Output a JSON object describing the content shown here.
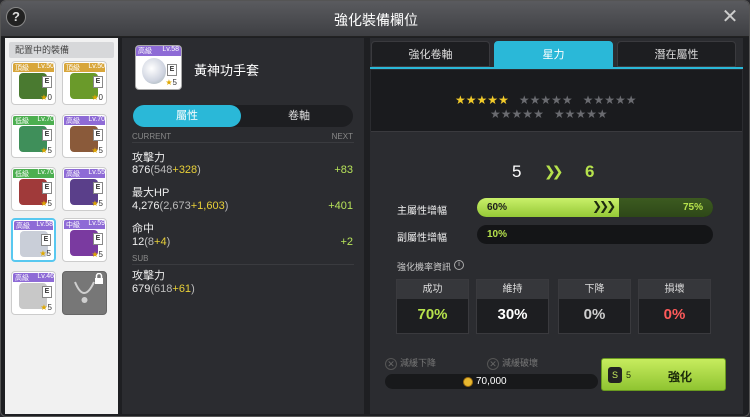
{
  "window": {
    "title": "強化裝備欄位",
    "help_label": "?",
    "close_label": "✕"
  },
  "equipment": {
    "header": "配置中的裝備",
    "slots": [
      {
        "tier": "頂級",
        "level": "Lv.50",
        "badge": "E",
        "stars": "0",
        "icon": "helmet-icon",
        "tier_color": "#d8a63a"
      },
      {
        "tier": "頂級",
        "level": "Lv.50",
        "badge": "E",
        "stars": "0",
        "icon": "cloak-icon",
        "tier_color": "#d8a63a"
      },
      {
        "tier": "低級",
        "level": "Lv.70",
        "badge": "E",
        "stars": "5",
        "icon": "top-armor-icon",
        "tier_color": "#4caf50"
      },
      {
        "tier": "高級",
        "level": "Lv.70",
        "badge": "E",
        "stars": "5",
        "icon": "shoes-icon",
        "tier_color": "#8e6bd6"
      },
      {
        "tier": "低級",
        "level": "Lv.70",
        "badge": "E",
        "stars": "5",
        "icon": "pants-icon",
        "tier_color": "#4caf50"
      },
      {
        "tier": "高級",
        "level": "Lv.55",
        "badge": "E",
        "stars": "5",
        "icon": "belt-icon",
        "tier_color": "#8e6bd6"
      },
      {
        "tier": "高級",
        "level": "Lv.58",
        "badge": "E",
        "stars": "5",
        "icon": "glove-icon",
        "tier_color": "#8e6bd6"
      },
      {
        "tier": "中級",
        "level": "Lv.59",
        "badge": "E",
        "stars": "5",
        "icon": "shoulder-icon",
        "tier_color": "#8e6bd6"
      },
      {
        "tier": "高級",
        "level": "Lv.46",
        "badge": "E",
        "stars": "5",
        "icon": "ring-icon",
        "tier_color": "#8e6bd6"
      }
    ]
  },
  "item": {
    "tier": "高級",
    "level": "Lv.58",
    "badge": "E",
    "stars": "5",
    "name": "黃神功手套",
    "tabs": {
      "attributes": "屬性",
      "scrolls": "卷軸"
    },
    "current_caption": "CURRENT",
    "next_caption": "NEXT",
    "sub_caption": "SUB",
    "stats": [
      {
        "name": "攻擊力",
        "total": "876",
        "base": "(548",
        "bonus": "+328",
        "close": ")",
        "next": "+83"
      },
      {
        "name": "最大HP",
        "total": "4,276",
        "base": "(2,673",
        "bonus": "+1,603",
        "close": ")",
        "next": "+401"
      },
      {
        "name": "命中",
        "total": "12",
        "base": "(8",
        "bonus": "+4",
        "close": ")",
        "next": "+2"
      }
    ],
    "sub_stats": [
      {
        "name": "攻擊力",
        "total": "679",
        "base": "(618",
        "bonus": "+61",
        "close": ")"
      }
    ]
  },
  "enhance": {
    "tabs": {
      "scroll": "強化卷軸",
      "starforce": "星力",
      "potential": "潛在屬性"
    },
    "stars_filled": 5,
    "stars_total": 25,
    "current_star": "5",
    "next_star": "6",
    "main_label": "主屬性增幅",
    "main_current": "60%",
    "main_next": "75%",
    "main_current_fraction": 0.6,
    "main_next_fraction": 0.75,
    "sub_label": "副屬性增幅",
    "sub_current": "10%",
    "prob_title": "強化機率資訊",
    "probabilities": [
      {
        "label": "成功",
        "value": "70%",
        "color": "#b6e24c"
      },
      {
        "label": "維持",
        "value": "30%",
        "color": "#ffffff"
      },
      {
        "label": "下降",
        "value": "0%",
        "color": "#cfcfcf"
      },
      {
        "label": "損壞",
        "value": "0%",
        "color": "#ff5a5a"
      }
    ],
    "option_reduce_drop": "減緩下降",
    "option_reduce_break": "減緩破壞",
    "cost": "70,000",
    "button_count": "5",
    "button_label": "強化"
  }
}
